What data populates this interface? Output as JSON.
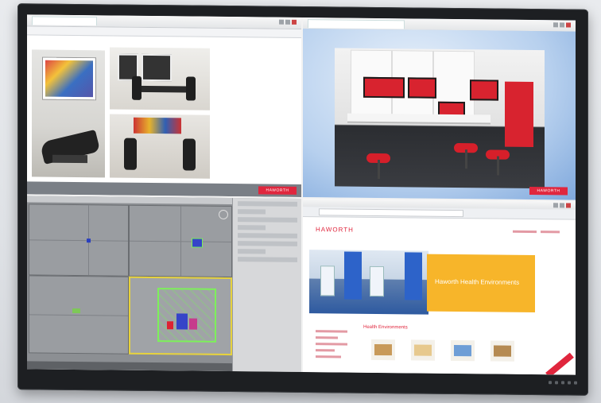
{
  "q1": {
    "logo": "HAWORTH"
  },
  "q2": {
    "logo": "HAWORTH"
  },
  "q4": {
    "logo": "HAWORTH",
    "hero_title": "Haworth Health Environments",
    "section_title": "Health Environments"
  },
  "colors": {
    "brand_red": "#e0263d",
    "hero_orange": "#f7b52a",
    "wireframe_green": "#7df05a",
    "viewport_highlight": "#e6d23d"
  }
}
